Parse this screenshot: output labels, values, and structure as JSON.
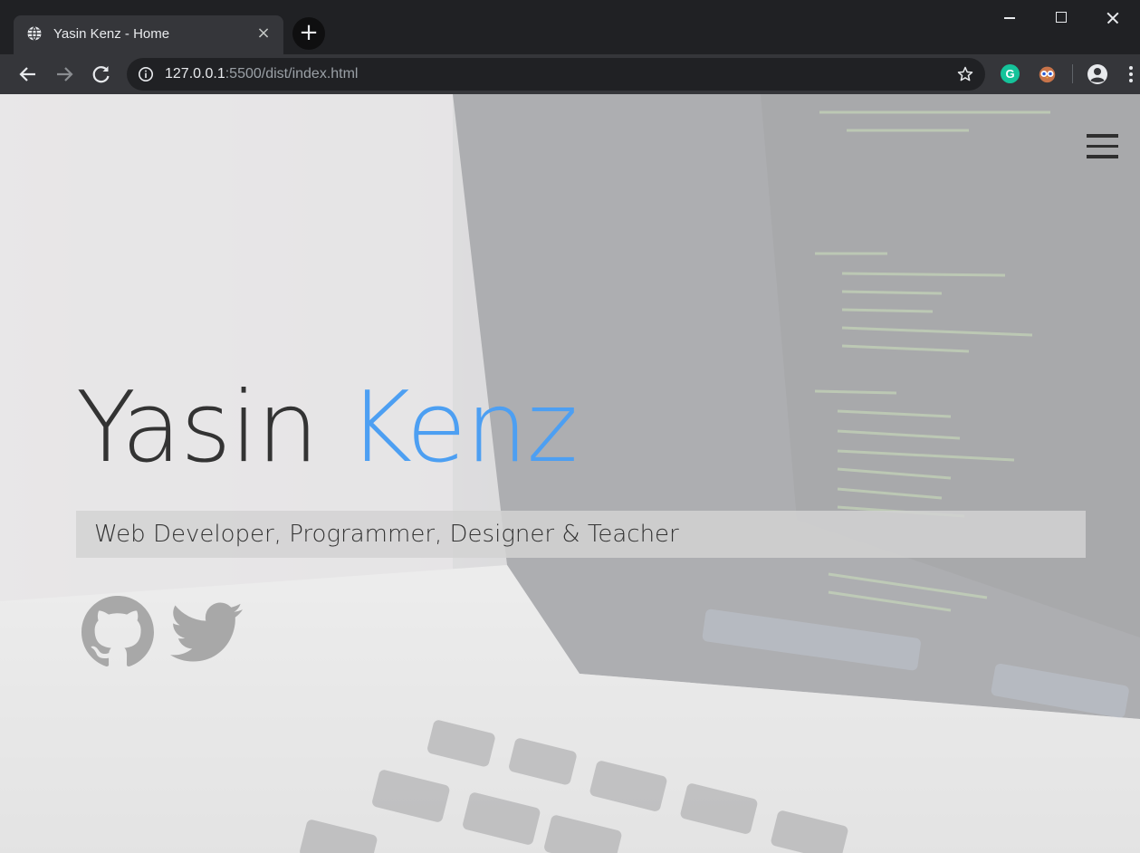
{
  "browser": {
    "tab": {
      "title": "Yasin Kenz - Home",
      "close_glyph": "×",
      "favicon": "globe-icon"
    },
    "new_tab_glyph": "+",
    "url": {
      "host": "127.0.0.1",
      "path": ":5500/dist/index.html"
    },
    "extensions": {
      "grammarly_letter": "G"
    }
  },
  "page": {
    "hero": {
      "first_name": "Yasin",
      "last_name": "Kenz",
      "tagline": "Web Developer, Programmer, Designer & Teacher"
    },
    "social": [
      {
        "name": "github",
        "icon": "github-icon"
      },
      {
        "name": "twitter",
        "icon": "twitter-icon"
      }
    ],
    "colors": {
      "accent": "#4d9ff2",
      "name_dark": "#333333",
      "icon_gray": "#a8a8a8"
    }
  }
}
